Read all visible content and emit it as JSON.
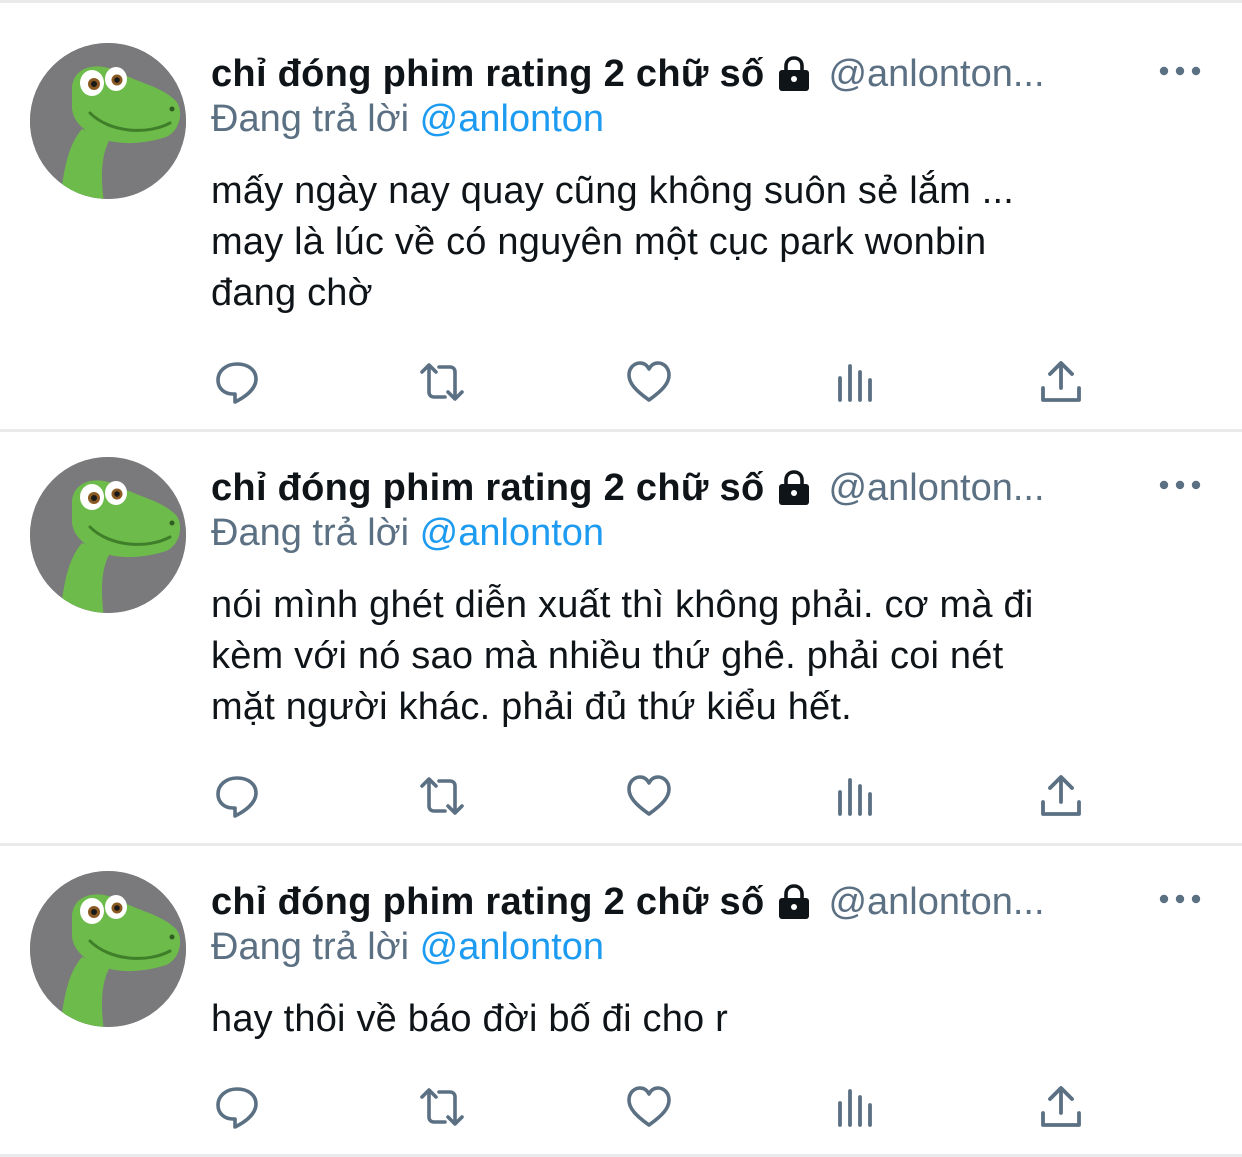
{
  "colors": {
    "primary_text": "#0f1419",
    "secondary_text": "#5b7083",
    "mention": "#1d9bf0",
    "icon": "#5b7083",
    "divider": "#e8eaec",
    "avatar_background": "#7a7a7c",
    "avatar_character": "#6dbb4a"
  },
  "tweets": [
    {
      "display_name": "chỉ đóng phim rating 2 chữ số",
      "handle": "@anlonton...",
      "reply_prefix": "Đang trả lời",
      "reply_to": "@anlonton",
      "lines": [
        "mấy ngày nay quay cũng không suôn sẻ lắm ...",
        "may là lúc về có nguyên một cục park wonbin",
        "đang chờ"
      ],
      "avatar_icon": "dinosaur-avatar-icon",
      "badge_icon": "lock-icon",
      "action_icons": [
        "reply-icon",
        "retweet-icon",
        "like-icon",
        "analytics-icon",
        "share-icon"
      ]
    },
    {
      "display_name": "chỉ đóng phim rating 2 chữ số",
      "handle": "@anlonton...",
      "reply_prefix": "Đang trả lời",
      "reply_to": "@anlonton",
      "lines": [
        "nói mình ghét diễn xuất thì không phải. cơ mà đi",
        "kèm với nó sao mà nhiều thứ ghê. phải coi nét",
        "mặt người khác. phải đủ thứ kiểu hết."
      ],
      "avatar_icon": "dinosaur-avatar-icon",
      "badge_icon": "lock-icon",
      "action_icons": [
        "reply-icon",
        "retweet-icon",
        "like-icon",
        "analytics-icon",
        "share-icon"
      ]
    },
    {
      "display_name": "chỉ đóng phim rating 2 chữ số",
      "handle": "@anlonton...",
      "reply_prefix": "Đang trả lời",
      "reply_to": "@anlonton",
      "lines": [
        "hay thôi về báo đời bố đi cho r"
      ],
      "avatar_icon": "dinosaur-avatar-icon",
      "badge_icon": "lock-icon",
      "action_icons": [
        "reply-icon",
        "retweet-icon",
        "like-icon",
        "analytics-icon",
        "share-icon"
      ]
    }
  ]
}
